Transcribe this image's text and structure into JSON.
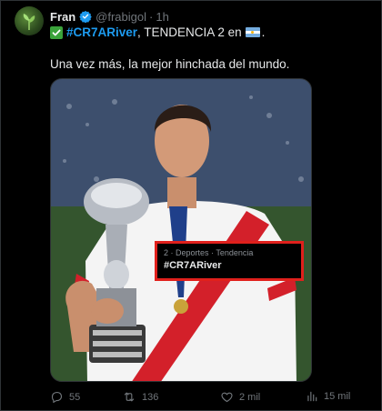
{
  "author": {
    "display_name": "Fran",
    "handle": "@frabigol",
    "separator": "·",
    "time": "1h"
  },
  "text": {
    "hashtag": "#CR7ARiver",
    "line1_rest": ", TENDENCIA 2 en",
    "line1_end": ".",
    "line2": "Una vez más, la mejor hinchada del mundo."
  },
  "trend_card": {
    "meta": "2 · Deportes · Tendencia",
    "tag": "#CR7ARiver",
    "border_color": "#e0201c"
  },
  "actions": {
    "replies": "55",
    "reposts": "136",
    "likes": "2 mil",
    "views": "15 mil"
  },
  "colors": {
    "background": "#000000",
    "link": "#1d9bf0",
    "muted": "#71767b",
    "verified": "#1d9bf0"
  },
  "icons": [
    "avatar",
    "verified-badge-icon",
    "check-mark-emoji-icon",
    "argentina-flag-icon",
    "reply-icon",
    "repost-icon",
    "like-icon",
    "views-icon"
  ]
}
